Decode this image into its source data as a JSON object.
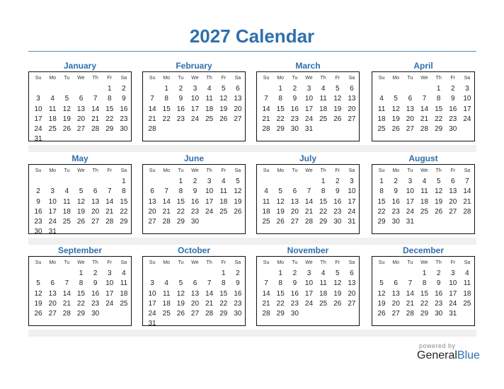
{
  "title": "2027 Calendar",
  "weekdays": [
    "Su",
    "Mo",
    "Tu",
    "We",
    "Th",
    "Fr",
    "Sa"
  ],
  "months": [
    {
      "name": "January",
      "weeks": [
        [
          "",
          "",
          "",
          "",
          "",
          "1",
          "2"
        ],
        [
          "3",
          "4",
          "5",
          "6",
          "7",
          "8",
          "9"
        ],
        [
          "10",
          "11",
          "12",
          "13",
          "14",
          "15",
          "16"
        ],
        [
          "17",
          "18",
          "19",
          "20",
          "21",
          "22",
          "23"
        ],
        [
          "24",
          "25",
          "26",
          "27",
          "28",
          "29",
          "30"
        ],
        [
          "31",
          "",
          "",
          "",
          "",
          "",
          ""
        ]
      ]
    },
    {
      "name": "February",
      "weeks": [
        [
          "",
          "1",
          "2",
          "3",
          "4",
          "5",
          "6"
        ],
        [
          "7",
          "8",
          "9",
          "10",
          "11",
          "12",
          "13"
        ],
        [
          "14",
          "15",
          "16",
          "17",
          "18",
          "19",
          "20"
        ],
        [
          "21",
          "22",
          "23",
          "24",
          "25",
          "26",
          "27"
        ],
        [
          "28",
          "",
          "",
          "",
          "",
          "",
          ""
        ],
        [
          "",
          "",
          "",
          "",
          "",
          "",
          ""
        ]
      ]
    },
    {
      "name": "March",
      "weeks": [
        [
          "",
          "1",
          "2",
          "3",
          "4",
          "5",
          "6"
        ],
        [
          "7",
          "8",
          "9",
          "10",
          "11",
          "12",
          "13"
        ],
        [
          "14",
          "15",
          "16",
          "17",
          "18",
          "19",
          "20"
        ],
        [
          "21",
          "22",
          "23",
          "24",
          "25",
          "26",
          "27"
        ],
        [
          "28",
          "29",
          "30",
          "31",
          "",
          "",
          ""
        ],
        [
          "",
          "",
          "",
          "",
          "",
          "",
          ""
        ]
      ]
    },
    {
      "name": "April",
      "weeks": [
        [
          "",
          "",
          "",
          "",
          "1",
          "2",
          "3"
        ],
        [
          "4",
          "5",
          "6",
          "7",
          "8",
          "9",
          "10"
        ],
        [
          "11",
          "12",
          "13",
          "14",
          "15",
          "16",
          "17"
        ],
        [
          "18",
          "19",
          "20",
          "21",
          "22",
          "23",
          "24"
        ],
        [
          "25",
          "26",
          "27",
          "28",
          "29",
          "30",
          ""
        ],
        [
          "",
          "",
          "",
          "",
          "",
          "",
          ""
        ]
      ]
    },
    {
      "name": "May",
      "weeks": [
        [
          "",
          "",
          "",
          "",
          "",
          "",
          "1"
        ],
        [
          "2",
          "3",
          "4",
          "5",
          "6",
          "7",
          "8"
        ],
        [
          "9",
          "10",
          "11",
          "12",
          "13",
          "14",
          "15"
        ],
        [
          "16",
          "17",
          "18",
          "19",
          "20",
          "21",
          "22"
        ],
        [
          "23",
          "24",
          "25",
          "26",
          "27",
          "28",
          "29"
        ],
        [
          "30",
          "31",
          "",
          "",
          "",
          "",
          ""
        ]
      ]
    },
    {
      "name": "June",
      "weeks": [
        [
          "",
          "",
          "1",
          "2",
          "3",
          "4",
          "5"
        ],
        [
          "6",
          "7",
          "8",
          "9",
          "10",
          "11",
          "12"
        ],
        [
          "13",
          "14",
          "15",
          "16",
          "17",
          "18",
          "19"
        ],
        [
          "20",
          "21",
          "22",
          "23",
          "24",
          "25",
          "26"
        ],
        [
          "27",
          "28",
          "29",
          "30",
          "",
          "",
          ""
        ],
        [
          "",
          "",
          "",
          "",
          "",
          "",
          ""
        ]
      ]
    },
    {
      "name": "July",
      "weeks": [
        [
          "",
          "",
          "",
          "",
          "1",
          "2",
          "3"
        ],
        [
          "4",
          "5",
          "6",
          "7",
          "8",
          "9",
          "10"
        ],
        [
          "11",
          "12",
          "13",
          "14",
          "15",
          "16",
          "17"
        ],
        [
          "18",
          "19",
          "20",
          "21",
          "22",
          "23",
          "24"
        ],
        [
          "25",
          "26",
          "27",
          "28",
          "29",
          "30",
          "31"
        ],
        [
          "",
          "",
          "",
          "",
          "",
          "",
          ""
        ]
      ]
    },
    {
      "name": "August",
      "weeks": [
        [
          "1",
          "2",
          "3",
          "4",
          "5",
          "6",
          "7"
        ],
        [
          "8",
          "9",
          "10",
          "11",
          "12",
          "13",
          "14"
        ],
        [
          "15",
          "16",
          "17",
          "18",
          "19",
          "20",
          "21"
        ],
        [
          "22",
          "23",
          "24",
          "25",
          "26",
          "27",
          "28"
        ],
        [
          "29",
          "30",
          "31",
          "",
          "",
          "",
          ""
        ],
        [
          "",
          "",
          "",
          "",
          "",
          "",
          ""
        ]
      ]
    },
    {
      "name": "September",
      "weeks": [
        [
          "",
          "",
          "",
          "1",
          "2",
          "3",
          "4"
        ],
        [
          "5",
          "6",
          "7",
          "8",
          "9",
          "10",
          "11"
        ],
        [
          "12",
          "13",
          "14",
          "15",
          "16",
          "17",
          "18"
        ],
        [
          "19",
          "20",
          "21",
          "22",
          "23",
          "24",
          "25"
        ],
        [
          "26",
          "27",
          "28",
          "29",
          "30",
          "",
          ""
        ],
        [
          "",
          "",
          "",
          "",
          "",
          "",
          ""
        ]
      ]
    },
    {
      "name": "October",
      "weeks": [
        [
          "",
          "",
          "",
          "",
          "",
          "1",
          "2"
        ],
        [
          "3",
          "4",
          "5",
          "6",
          "7",
          "8",
          "9"
        ],
        [
          "10",
          "11",
          "12",
          "13",
          "14",
          "15",
          "16"
        ],
        [
          "17",
          "18",
          "19",
          "20",
          "21",
          "22",
          "23"
        ],
        [
          "24",
          "25",
          "26",
          "27",
          "28",
          "29",
          "30"
        ],
        [
          "31",
          "",
          "",
          "",
          "",
          "",
          ""
        ]
      ]
    },
    {
      "name": "November",
      "weeks": [
        [
          "",
          "1",
          "2",
          "3",
          "4",
          "5",
          "6"
        ],
        [
          "7",
          "8",
          "9",
          "10",
          "11",
          "12",
          "13"
        ],
        [
          "14",
          "15",
          "16",
          "17",
          "18",
          "19",
          "20"
        ],
        [
          "21",
          "22",
          "23",
          "24",
          "25",
          "26",
          "27"
        ],
        [
          "28",
          "29",
          "30",
          "",
          "",
          "",
          ""
        ],
        [
          "",
          "",
          "",
          "",
          "",
          "",
          ""
        ]
      ]
    },
    {
      "name": "December",
      "weeks": [
        [
          "",
          "",
          "",
          "1",
          "2",
          "3",
          "4"
        ],
        [
          "5",
          "6",
          "7",
          "8",
          "9",
          "10",
          "11"
        ],
        [
          "12",
          "13",
          "14",
          "15",
          "16",
          "17",
          "18"
        ],
        [
          "19",
          "20",
          "21",
          "22",
          "23",
          "24",
          "25"
        ],
        [
          "26",
          "27",
          "28",
          "29",
          "30",
          "31",
          ""
        ],
        [
          "",
          "",
          "",
          "",
          "",
          "",
          ""
        ]
      ]
    }
  ],
  "footer": {
    "powered_by": "powered by",
    "brand_general": "General",
    "brand_blue": "Blue"
  },
  "colors": {
    "accent": "#2e6fae",
    "rule": "#4a90c8",
    "strip": "#f0f0f0"
  }
}
